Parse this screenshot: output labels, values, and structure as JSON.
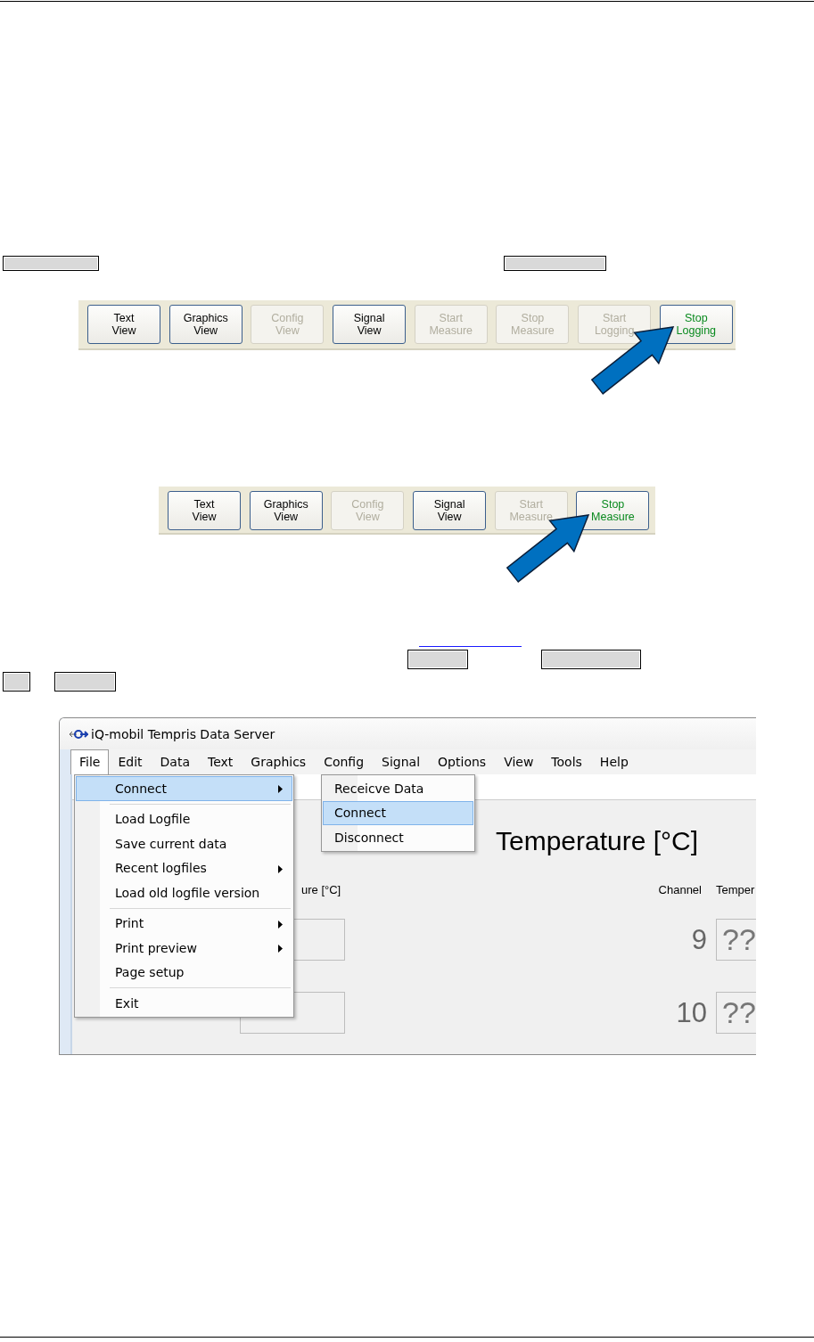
{
  "toolbars": [
    {
      "buttons": [
        {
          "label": "Text\nView",
          "disabled": false,
          "active": false
        },
        {
          "label": "Graphics\nView",
          "disabled": false,
          "active": false
        },
        {
          "label": "Config\nView",
          "disabled": true,
          "active": false
        },
        {
          "label": "Signal\nView",
          "disabled": false,
          "active": false
        },
        {
          "label": "Start\nMeasure",
          "disabled": true,
          "active": false
        },
        {
          "label": "Stop\nMeasure",
          "disabled": true,
          "active": false
        },
        {
          "label": "Start\nLogging",
          "disabled": true,
          "active": false
        },
        {
          "label": "Stop\nLogging",
          "disabled": false,
          "active": true
        }
      ]
    },
    {
      "buttons": [
        {
          "label": "Text\nView",
          "disabled": false,
          "active": false
        },
        {
          "label": "Graphics\nView",
          "disabled": false,
          "active": false
        },
        {
          "label": "Config\nView",
          "disabled": true,
          "active": false
        },
        {
          "label": "Signal\nView",
          "disabled": false,
          "active": false
        },
        {
          "label": "Start\nMeasure",
          "disabled": true,
          "active": false
        },
        {
          "label": "Stop\nMeasure",
          "disabled": false,
          "active": true
        }
      ]
    }
  ],
  "window": {
    "title": "iQ-mobil Tempris Data Server",
    "menu_bar": [
      {
        "label": "File",
        "selected": true
      },
      {
        "label": "Edit",
        "selected": false
      },
      {
        "label": "Data",
        "selected": false
      },
      {
        "label": "Text",
        "selected": false
      },
      {
        "label": "Graphics",
        "selected": false
      },
      {
        "label": "Config",
        "selected": false
      },
      {
        "label": "Signal",
        "selected": false
      },
      {
        "label": "Options",
        "selected": false
      },
      {
        "label": "View",
        "selected": false
      },
      {
        "label": "Tools",
        "selected": false
      },
      {
        "label": "Help",
        "selected": false
      }
    ],
    "file_menu": [
      {
        "kind": "item",
        "label": "Connect",
        "submenu": true,
        "selected": true
      },
      {
        "kind": "separator"
      },
      {
        "kind": "item",
        "label": "Load Logfile",
        "submenu": false,
        "selected": false
      },
      {
        "kind": "item",
        "label": "Save current data",
        "submenu": false,
        "selected": false
      },
      {
        "kind": "item",
        "label": "Recent logfiles",
        "submenu": true,
        "selected": false
      },
      {
        "kind": "item",
        "label": "Load old logfile version",
        "submenu": false,
        "selected": false
      },
      {
        "kind": "separator"
      },
      {
        "kind": "item",
        "label": "Print",
        "submenu": true,
        "selected": false
      },
      {
        "kind": "item",
        "label": "Print preview",
        "submenu": true,
        "selected": false
      },
      {
        "kind": "item",
        "label": "Page setup",
        "submenu": false,
        "selected": false
      },
      {
        "kind": "separator"
      },
      {
        "kind": "item",
        "label": "Exit",
        "submenu": false,
        "selected": false
      }
    ],
    "connect_submenu": [
      {
        "label": "Receicve Data",
        "selected": false
      },
      {
        "label": "Connect",
        "selected": true
      },
      {
        "label": "Disconnect",
        "selected": false
      }
    ],
    "heading": "Temperature [°C]",
    "left_column": {
      "header": "ure [°C]"
    },
    "right_column": {
      "channel_header": "Channel",
      "value_header": "Temper",
      "rows": [
        {
          "channel": "9",
          "value": "??"
        },
        {
          "channel": "10",
          "value": "??"
        }
      ]
    }
  }
}
